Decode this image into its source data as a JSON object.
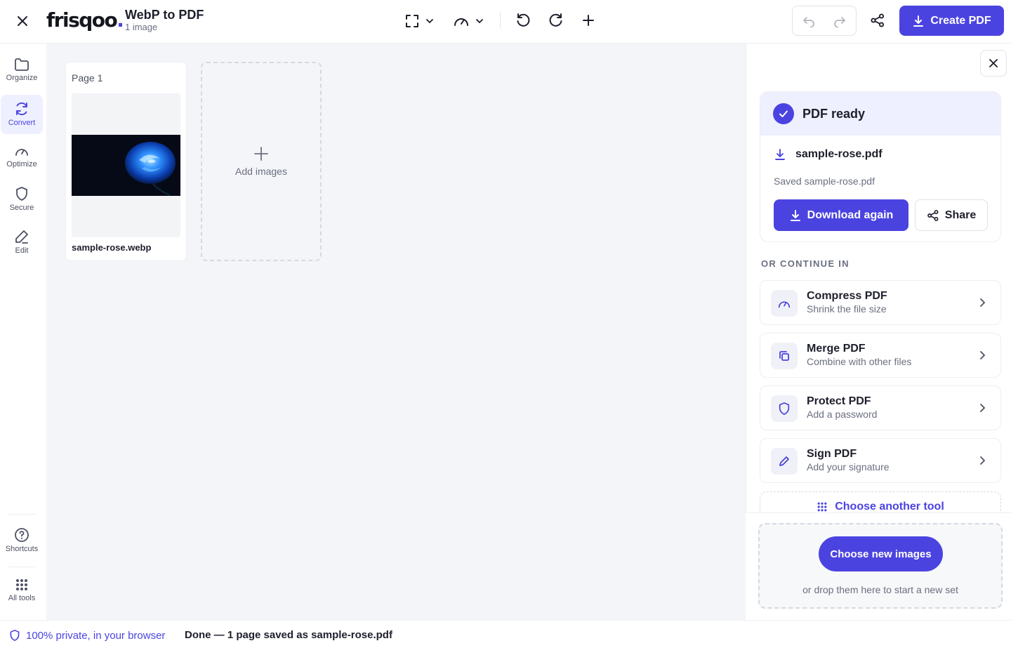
{
  "app": {
    "logo": "frisqoo",
    "logo_dot": ".",
    "title": "WebP to PDF",
    "subtitle": "1 image"
  },
  "toolbar": {
    "create_label": "Create PDF",
    "icons": [
      "close-icon",
      "fit-icon",
      "gauge-icon",
      "rotate-left-icon",
      "rotate-right-icon",
      "plus-icon",
      "undo-icon",
      "redo-icon",
      "share-icon",
      "download-icon"
    ]
  },
  "sidebar": {
    "items": [
      {
        "label": "Organize",
        "icon": "folder-icon"
      },
      {
        "label": "Convert",
        "icon": "refresh-icon",
        "active": true
      },
      {
        "label": "Optimize",
        "icon": "gauge-icon"
      },
      {
        "label": "Secure",
        "icon": "shield-icon"
      },
      {
        "label": "Edit",
        "icon": "pencil-icon"
      }
    ],
    "bottom": [
      {
        "label": "Shortcuts",
        "icon": "help-circle-icon"
      },
      {
        "label": "All tools",
        "icon": "grid-icon"
      }
    ]
  },
  "canvas": {
    "page_label": "Page 1",
    "filename": "sample-rose.webp",
    "add_label": "Add images"
  },
  "panel": {
    "ready_title": "PDF ready",
    "pdf_name": "sample-rose.pdf",
    "saved_text": "Saved sample-rose.pdf",
    "download_label": "Download again",
    "share_label": "Share",
    "continue_label": "OR CONTINUE IN",
    "tools": [
      {
        "title": "Compress PDF",
        "sub": "Shrink the file size",
        "icon": "gauge-icon"
      },
      {
        "title": "Merge PDF",
        "sub": "Combine with other files",
        "icon": "copy-icon"
      },
      {
        "title": "Protect PDF",
        "sub": "Add a password",
        "icon": "shield-icon"
      },
      {
        "title": "Sign PDF",
        "sub": "Add your signature",
        "icon": "pen-icon"
      }
    ],
    "another_label": "Choose another tool",
    "choose_label": "Choose new images",
    "drop_hint": "or drop them here to start a new set"
  },
  "footer": {
    "privacy": "100% private, in your browser",
    "status": "Done — 1 page saved as sample-rose.pdf"
  },
  "colors": {
    "accent": "#4b43e0",
    "accent_soft": "#eef0ff",
    "canvas_bg": "#f4f5f8"
  }
}
